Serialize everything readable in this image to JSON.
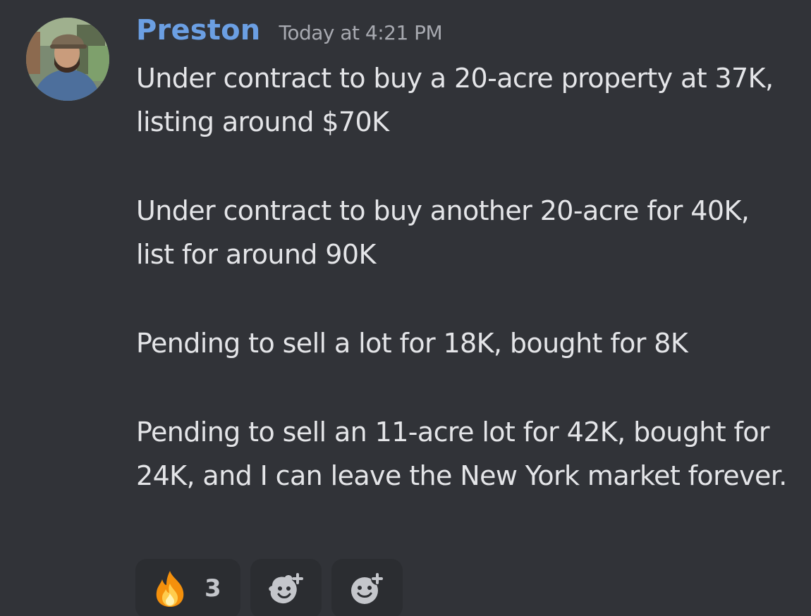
{
  "message": {
    "author": "Preston",
    "timestamp": "Today at 4:21 PM",
    "paragraphs": [
      "Under contract to buy a 20-acre property at 37K, listing around $70K",
      "Under contract to buy another 20-acre for 40K, list for around 90K",
      "Pending to sell a lot for 18K, bought for 8K",
      "Pending to sell an 11-acre lot for 42K, bought for 24K, and I can leave the New York market forever."
    ]
  },
  "reactions": [
    {
      "emoji": "fire-emoji",
      "count": "3"
    },
    {
      "icon": "add-super-reaction-icon"
    },
    {
      "icon": "add-reaction-icon"
    }
  ],
  "colors": {
    "background": "#313338",
    "username": "#6b9fe3",
    "text": "#e4e5e8",
    "muted": "#a8aab1",
    "reaction_bg": "#2b2d31"
  }
}
